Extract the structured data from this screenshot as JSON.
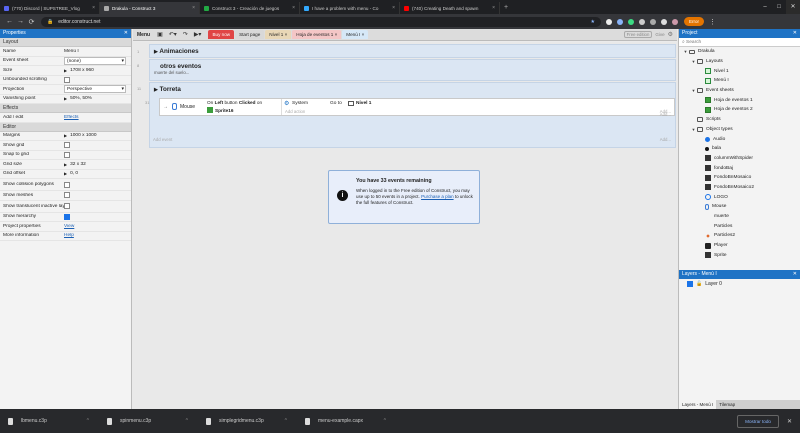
{
  "browser": {
    "tabs": [
      {
        "label": "(770) Discord | SUPSTREE_Vlog",
        "color": "#5865f2"
      },
      {
        "label": "Drakula - Construct 3",
        "color": "#aaaaaa",
        "active": true
      },
      {
        "label": "Construct 3 - Creación de juegos",
        "color": "#22aa44"
      },
      {
        "label": "I have a problem with menu - Co",
        "color": "#33aaff"
      },
      {
        "label": "(740) Creating Death and spawn",
        "color": "#ff0000"
      }
    ],
    "url": "editor.construct.net",
    "error_label": "Error"
  },
  "properties": {
    "title": "Properties",
    "sections": [
      {
        "name": "Layout",
        "rows": [
          {
            "key": "Name",
            "value": "Menú I",
            "kind": "text"
          },
          {
            "key": "Event sheet",
            "value": "(none)",
            "kind": "select"
          },
          {
            "key": "Size",
            "value": "1708 x 960",
            "kind": "text"
          },
          {
            "key": "Unbounded scrolling",
            "value": "",
            "kind": "check",
            "checked": false
          },
          {
            "key": "Projection",
            "value": "Perspective",
            "kind": "select"
          },
          {
            "key": "Vanishing point",
            "value": "50%, 50%",
            "kind": "text"
          }
        ]
      },
      {
        "name": "Effects",
        "rows": [
          {
            "key": "Add / edit",
            "value": "Effects",
            "kind": "link"
          }
        ]
      },
      {
        "name": "Editor",
        "rows": [
          {
            "key": "Margins",
            "value": "1000 x 1000",
            "kind": "text"
          },
          {
            "key": "Show grid",
            "value": "",
            "kind": "check",
            "checked": false
          },
          {
            "key": "Snap to grid",
            "value": "",
            "kind": "check",
            "checked": false
          },
          {
            "key": "Grid size",
            "value": "32 x 32",
            "kind": "text"
          },
          {
            "key": "Grid offset",
            "value": "0, 0",
            "kind": "text"
          },
          {
            "key": "Show collision polygons",
            "value": "",
            "kind": "check",
            "checked": false
          },
          {
            "key": "Show meshes",
            "value": "",
            "kind": "check",
            "checked": false
          },
          {
            "key": "Show translucent inactive layers",
            "value": "",
            "kind": "check",
            "checked": false
          },
          {
            "key": "Show hierarchy",
            "value": "",
            "kind": "check",
            "checked": true
          }
        ]
      }
    ],
    "footer": [
      {
        "key": "Project properties",
        "value": "View"
      },
      {
        "key": "More information",
        "value": "Help"
      }
    ]
  },
  "editor": {
    "menu_label": "Menu",
    "buy_now": "Buy now",
    "doc_tabs": [
      {
        "label": "Start page",
        "bg": "#d8d8d8"
      },
      {
        "label": "Nivel 1",
        "bg": "#e8d7b6"
      },
      {
        "label": "Hoja de eventos 1",
        "bg": "#f4c6c6"
      },
      {
        "label": "Menú I",
        "bg": "#d6e8f7"
      }
    ],
    "free_edition": "Free edition",
    "give": "Give",
    "groups": [
      {
        "title": "Animaciones",
        "sub": "",
        "line": "1"
      },
      {
        "title": "otros eventos",
        "sub": "muerte del suelo...",
        "line": "8"
      },
      {
        "title": "Torreta",
        "sub": "",
        "line": "11"
      }
    ],
    "event": {
      "line": "31",
      "object": "Mouse",
      "condition_pre": "On",
      "condition_bold": "Left",
      "condition_mid": "button",
      "condition_bold2": "Clicked",
      "condition_post": "on",
      "target": "Sprite16",
      "action_object": "System",
      "action_pre": "Go to",
      "action_target": "Nivel 1",
      "add_action": "Add action",
      "add_event": "Add event",
      "add_more": "Add..."
    },
    "dialog": {
      "title": "You have 33 events remaining",
      "line1": "When logged in to the Free edition of Construct, you may use up to 50 events in a project.",
      "link": "Purchase a plan",
      "line2": "to unlock the full features of Construct."
    }
  },
  "project": {
    "title": "Project",
    "search": "Search",
    "tree": [
      {
        "label": "Drakula",
        "depth": 0,
        "type": "folder",
        "exp": true
      },
      {
        "label": "Layouts",
        "depth": 1,
        "type": "folder",
        "exp": true
      },
      {
        "label": "Nivel 1",
        "depth": 2,
        "type": "layout"
      },
      {
        "label": "Menú I",
        "depth": 2,
        "type": "layout"
      },
      {
        "label": "Event sheets",
        "depth": 1,
        "type": "folder",
        "exp": true
      },
      {
        "label": "Hoja de eventos 1",
        "depth": 2,
        "type": "sheet"
      },
      {
        "label": "Hoja de eventos 2",
        "depth": 2,
        "type": "sheet"
      },
      {
        "label": "Scripts",
        "depth": 1,
        "type": "folder"
      },
      {
        "label": "Object types",
        "depth": 1,
        "type": "folder",
        "exp": true
      },
      {
        "label": "Audio",
        "depth": 2,
        "type": "audio"
      },
      {
        "label": "bala",
        "depth": 2,
        "type": "bullet"
      },
      {
        "label": "columnWithSpider",
        "depth": 2,
        "type": "sprite-dark"
      },
      {
        "label": "fondoBaj",
        "depth": 2,
        "type": "sprite-dark"
      },
      {
        "label": "FondoBnMosaico",
        "depth": 2,
        "type": "sprite-dark"
      },
      {
        "label": "FondoBnMosaico2",
        "depth": 2,
        "type": "sprite-dark"
      },
      {
        "label": "LOGO",
        "depth": 2,
        "type": "sprite-blue"
      },
      {
        "label": "Mouse",
        "depth": 2,
        "type": "mouse"
      },
      {
        "label": "muerte",
        "depth": 2,
        "type": "blank"
      },
      {
        "label": "Particles",
        "depth": 2,
        "type": "blank"
      },
      {
        "label": "Particles2",
        "depth": 2,
        "type": "particles"
      },
      {
        "label": "Player",
        "depth": 2,
        "type": "player"
      },
      {
        "label": "Sprite",
        "depth": 2,
        "type": "sprite-dark"
      }
    ]
  },
  "layers": {
    "title": "Layers - Menú I",
    "layer_name": "Layer 0",
    "tabs": [
      "Layers - Menú I",
      "Tilemap"
    ]
  },
  "downloads": {
    "files": [
      "lbmenu.c3p",
      "spinmenu.c3p",
      "simplegridmenu.c3p",
      "menu-example.capx"
    ],
    "show_all": "Mostrar todo"
  }
}
